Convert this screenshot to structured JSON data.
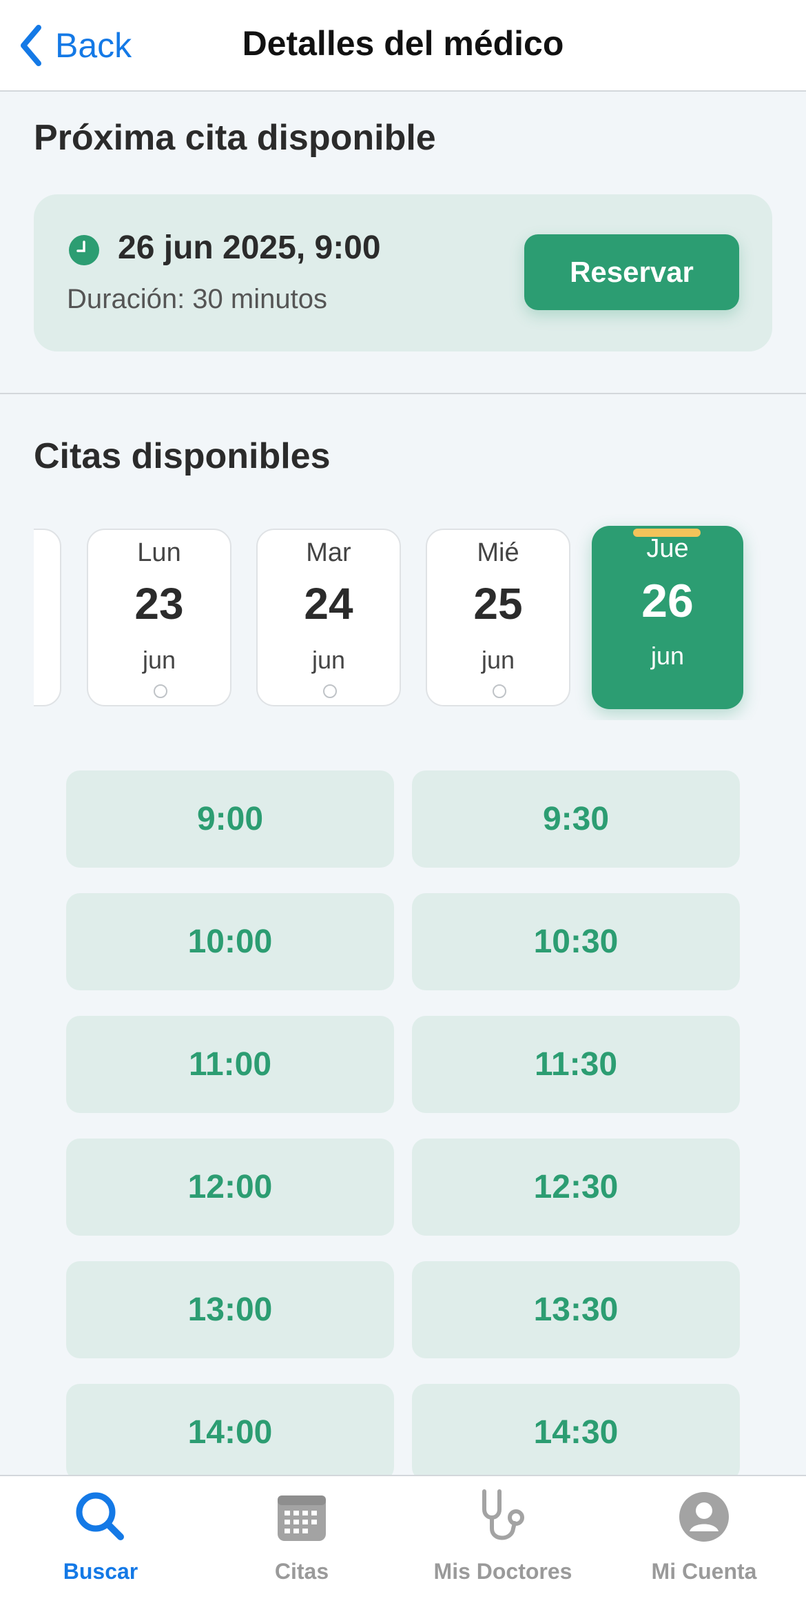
{
  "header": {
    "back_label": "Back",
    "title": "Detalles del médico"
  },
  "next_appointment": {
    "section_title": "Próxima cita disponible",
    "date_time": "26 jun 2025, 9:00",
    "duration": "Duración: 30 minutos",
    "reserve_label": "Reservar",
    "accent_color": "#2c9d72"
  },
  "available": {
    "section_title": "Citas disponibles",
    "days": [
      {
        "name": "Lun",
        "num": "23",
        "month": "jun",
        "selected": false
      },
      {
        "name": "Mar",
        "num": "24",
        "month": "jun",
        "selected": false
      },
      {
        "name": "Mié",
        "num": "25",
        "month": "jun",
        "selected": false
      },
      {
        "name": "Jue",
        "num": "26",
        "month": "jun",
        "selected": true
      }
    ],
    "slots": [
      "9:00",
      "9:30",
      "10:00",
      "10:30",
      "11:00",
      "11:30",
      "12:00",
      "12:30",
      "13:00",
      "13:30",
      "14:00",
      "14:30"
    ]
  },
  "tabbar": {
    "items": [
      {
        "label": "Buscar",
        "icon": "search-icon",
        "active": true
      },
      {
        "label": "Citas",
        "icon": "calendar-icon",
        "active": false
      },
      {
        "label": "Mis Doctores",
        "icon": "stethoscope-icon",
        "active": false
      },
      {
        "label": "Mi Cuenta",
        "icon": "account-icon",
        "active": false
      }
    ],
    "active_color": "#1479e6"
  }
}
